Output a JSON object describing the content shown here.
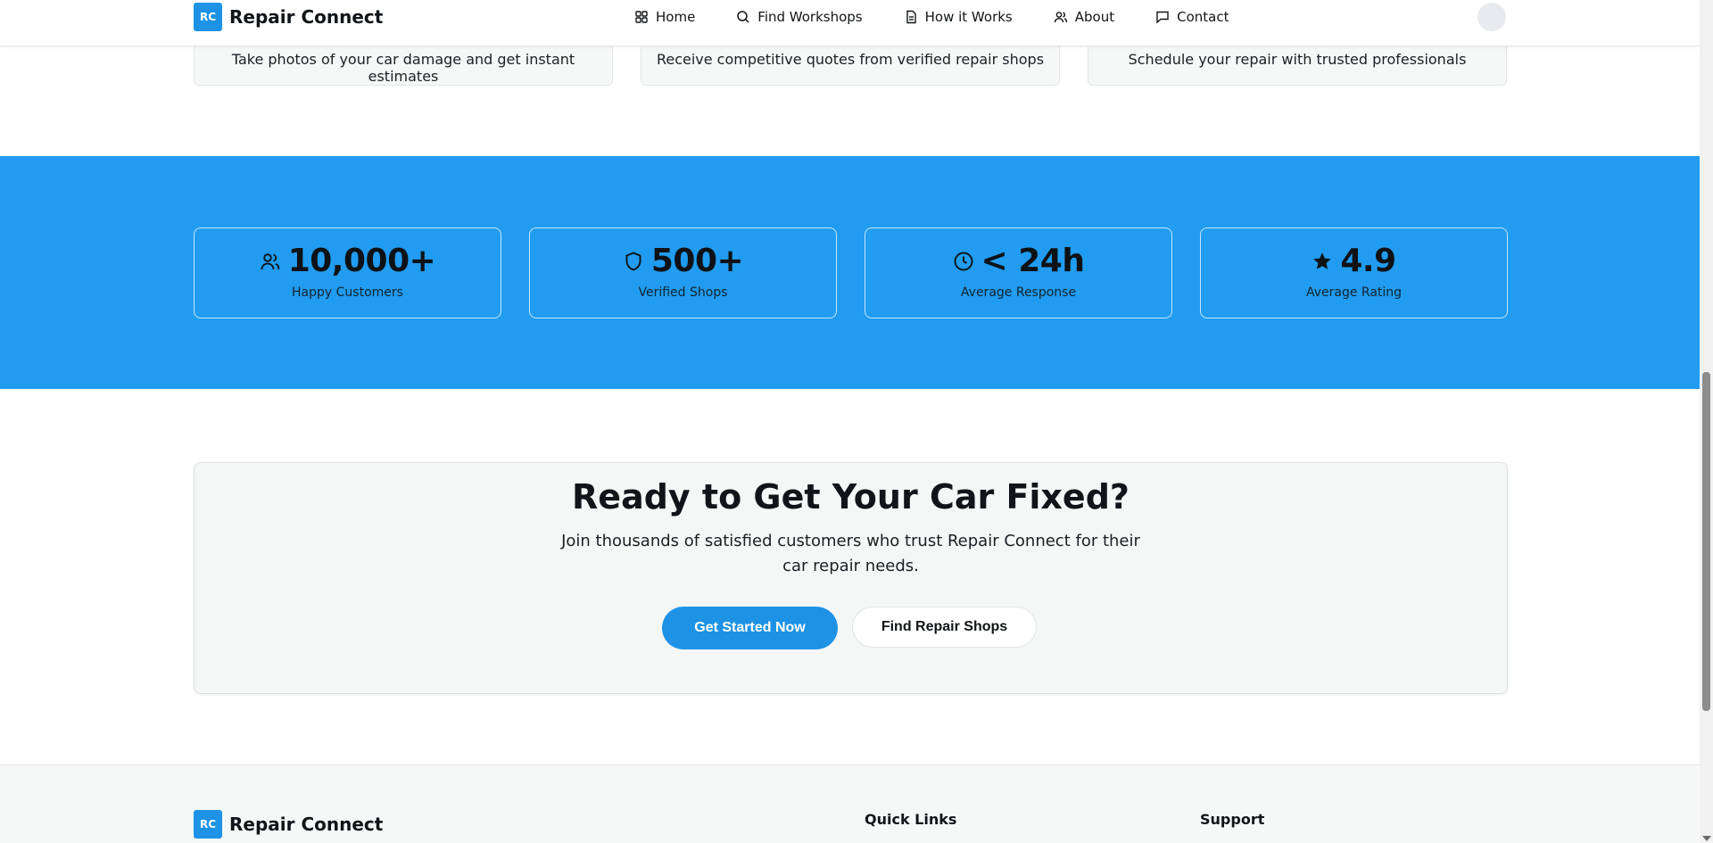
{
  "header": {
    "logo_text": "RC",
    "brand": "Repair Connect",
    "nav": [
      {
        "label": "Home",
        "icon": "grid-icon"
      },
      {
        "label": "Find Workshops",
        "icon": "search-icon"
      },
      {
        "label": "How it Works",
        "icon": "document-icon"
      },
      {
        "label": "About",
        "icon": "users-icon"
      },
      {
        "label": "Contact",
        "icon": "chat-icon"
      }
    ]
  },
  "features": [
    {
      "text": "Take photos of your car damage and get instant estimates"
    },
    {
      "text": "Receive competitive quotes from verified repair shops"
    },
    {
      "text": "Schedule your repair with trusted professionals"
    }
  ],
  "stats": [
    {
      "value": "10,000+",
      "label": "Happy Customers",
      "icon": "users-icon"
    },
    {
      "value": "500+",
      "label": "Verified Shops",
      "icon": "shield-icon"
    },
    {
      "value": "< 24h",
      "label": "Average Response",
      "icon": "clock-icon"
    },
    {
      "value": "4.9",
      "label": "Average Rating",
      "icon": "star-icon"
    }
  ],
  "cta": {
    "title": "Ready to Get Your Car Fixed?",
    "subtitle": "Join thousands of satisfied customers who trust Repair Connect for their car repair needs.",
    "primary_button": "Get Started Now",
    "secondary_button": "Find Repair Shops"
  },
  "footer": {
    "logo_text": "RC",
    "brand": "Repair Connect",
    "quick_links_heading": "Quick Links",
    "support_heading": "Support"
  },
  "colors": {
    "accent": "#1e93e6",
    "stats_band": "#219cf0",
    "card_bg": "#f6f7f7"
  }
}
